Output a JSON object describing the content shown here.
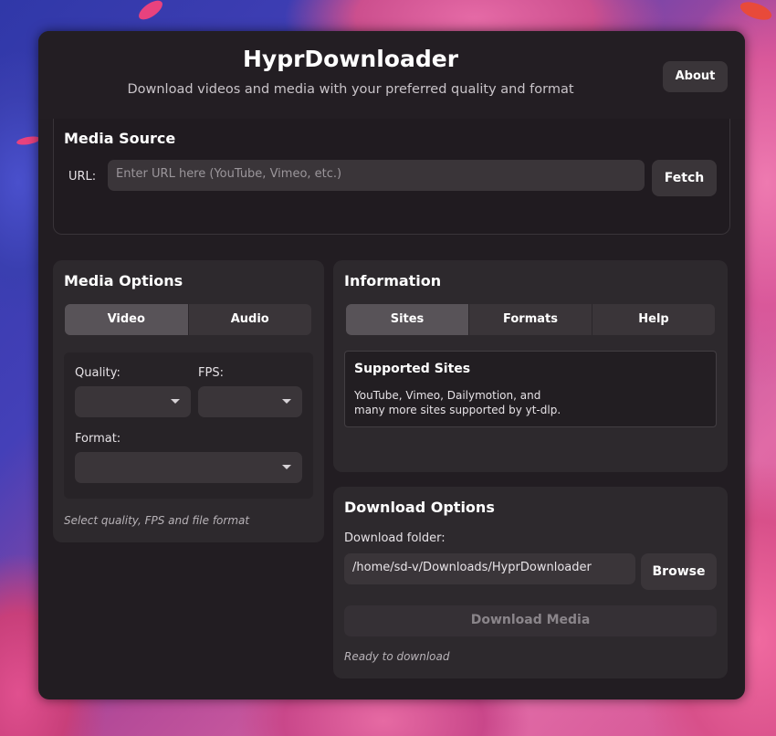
{
  "app": {
    "title": "HyprDownloader",
    "subtitle": "Download videos and media with your preferred quality and format",
    "about_label": "About"
  },
  "media_source": {
    "title": "Media Source",
    "url_label": "URL:",
    "url_placeholder": "Enter URL here (YouTube, Vimeo, etc.)",
    "url_value": "",
    "fetch_label": "Fetch"
  },
  "media_options": {
    "title": "Media Options",
    "tabs": [
      {
        "label": "Video",
        "active": true
      },
      {
        "label": "Audio",
        "active": false
      }
    ],
    "quality_label": "Quality:",
    "quality_value": "",
    "fps_label": "FPS:",
    "fps_value": "",
    "format_label": "Format:",
    "format_value": "",
    "hint": "Select quality, FPS and file format"
  },
  "information": {
    "title": "Information",
    "tabs": [
      {
        "label": "Sites",
        "active": true
      },
      {
        "label": "Formats",
        "active": false
      },
      {
        "label": "Help",
        "active": false
      }
    ],
    "panel_title": "Supported Sites",
    "panel_text_line1": "YouTube, Vimeo, Dailymotion, and",
    "panel_text_line2": "many more sites supported by yt-dlp."
  },
  "download_options": {
    "title": "Download Options",
    "folder_label": "Download folder:",
    "folder_value": "/home/sd-v/Downloads/HyprDownloader",
    "browse_label": "Browse",
    "download_label": "Download Media",
    "status": "Ready to download"
  },
  "colors": {
    "window_bg": "#221d22",
    "card_bg": "#2d292d",
    "button_bg": "#3a3539",
    "active_tab": "#585358"
  },
  "icons": {
    "dropdown": "chevron-down-icon"
  }
}
